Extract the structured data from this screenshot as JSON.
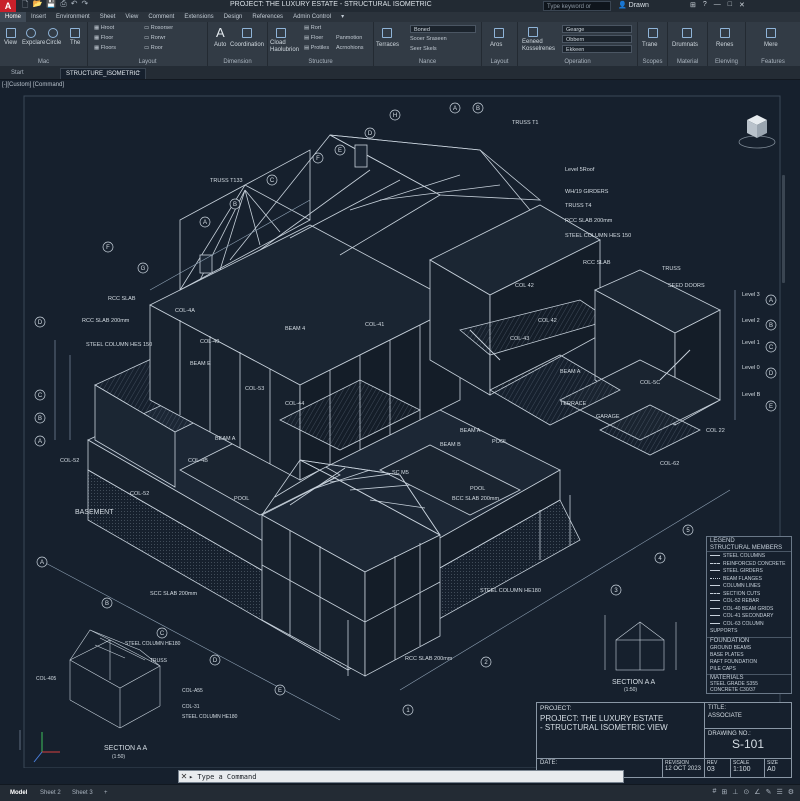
{
  "app": {
    "logo_letter": "A",
    "window_title": "PROJECT: THE LUXURY ESTATE - STRUCTURAL ISOMETRIC",
    "search_placeholder": "Type keyword or phrase",
    "user_name": "Drawn",
    "accent_color": "#c8202a"
  },
  "quick_access": [
    "🗋",
    "📂",
    "💾",
    "⎙",
    "↶",
    "↷"
  ],
  "menu_tabs": [
    "Home",
    "Insert",
    "Environment",
    "Sheet",
    "View",
    "Comment",
    "Extensions",
    "Design",
    "References",
    "Admin Control"
  ],
  "ribbon": {
    "groups": [
      {
        "label": "Mac",
        "tools": [
          "View",
          "Expclare",
          "Circle",
          "The"
        ]
      },
      {
        "label": "Layout",
        "tools": [
          "Hroot",
          "Floor",
          "Floors",
          "Rosorser",
          "Rorwr",
          "Roor"
        ]
      },
      {
        "label": "Dimension",
        "tools": [
          "Auto",
          "Coordination"
        ]
      },
      {
        "label": "Structure",
        "tools": [
          "Cload Haolubrion",
          "Rort",
          "Floer",
          "Protiles",
          "Panmotion",
          "Acrnohions"
        ]
      },
      {
        "label": "Nance",
        "tools": [
          "Terraces",
          "Boned",
          "Sooer Sraseen",
          "Seer Skels"
        ]
      },
      {
        "label": "Layout",
        "tools": [
          "Aros"
        ]
      },
      {
        "label": "Operation",
        "tools": [
          "Eeneed Kosselrenes",
          "Gearge",
          "Obbern",
          "Ekkeen"
        ]
      },
      {
        "label": "Scopes",
        "tools": [
          "Trane"
        ]
      },
      {
        "label": "Material",
        "tools": [
          "Drumnats"
        ]
      },
      {
        "label": "Elenving",
        "tools": [
          "Renes"
        ]
      },
      {
        "label": "Features",
        "tools": [
          "Mere"
        ]
      }
    ]
  },
  "doc_tabs": [
    "Start",
    "STRUCTURE_ISOMETRIC"
  ],
  "view_label": "[-][Custom] [Command]",
  "drawing": {
    "labels": {
      "truss_t1": "TRUSS T1",
      "truss_t133": "TRUSS T133",
      "level_5roof": "Level 5Roof",
      "wh_girders": "WH/19 GIRDERS",
      "truss_t4": "TRUSS T4",
      "rc_slab_200": "RCC SLAB 200mm",
      "steel_col_hes": "STEEL COLUMN HES 150",
      "rcc_slab": "RCC SLAB",
      "truss": "TRUSS",
      "seed_doors": "SEED DOORS",
      "rcc_slab_left": "RCC SLAB",
      "rcc_slab_200mm": "RCC SLAB 200mm",
      "steel_column_hes": "STEEL COLUMN HES 150",
      "col_4a": "COL-4A",
      "col_42": "COL 42",
      "col_41": "COL-41",
      "col_43": "COL-43",
      "col_52": "COL-52",
      "col_40": "COL-40",
      "col_53": "COL-53",
      "col_5c": "COL-5C",
      "col_44": "COL-44",
      "col_22": "COL 22",
      "col_62": "COL-62",
      "col_52b": "COL-52",
      "col_4b": "COL-4B",
      "beam_a": "BEAM A",
      "beam_e": "BEAM E",
      "beam_b": "BEAM B",
      "beam_4": "BEAM 4",
      "basement": "BASEMENT",
      "pool": "POOL",
      "pool2": "POOL",
      "pool3": "POOL",
      "garage": "GARAGE",
      "terrace": "TERRACE",
      "sc_m5": "SC M5",
      "scc_slab": "SCC SLAB 200mm",
      "bcc_slab_200": "BCC SLAB 200mm",
      "steel_column_b": "STEEL COLUMN HE180",
      "rcc_slab_bottom": "RCC SLAB 200mm",
      "level3": "Level 3",
      "level2": "Level 2",
      "level1": "Level 1",
      "level0": "Level 0",
      "level_b": "Level B",
      "section_aa": "SECTION A A",
      "section_aa_sub": "(1:50)",
      "section_a": "SECTION A A",
      "section_a_sub": "(1:50)",
      "steel_column_detail": "STEEL COLUMN HE180",
      "truss_detail": "TRUSS",
      "col_405": "COL-405",
      "col_a55": "COL-A55",
      "col_31": "COL-31",
      "steel_column_hes2": "STEEL COLUMN HE180"
    },
    "grid_letters": [
      "A",
      "B",
      "C",
      "D",
      "E",
      "F",
      "G",
      "H"
    ],
    "grid_numbers": [
      "1",
      "2",
      "3",
      "4",
      "5",
      "6",
      "7",
      "8"
    ]
  },
  "legend": {
    "title": "LEGEND",
    "section_title": "STRUCTURAL MEMBERS",
    "items": [
      "STEEL COLUMNS",
      "REINFORCED CONCRETE",
      "STEEL GIRDERS",
      "BEAM FLANGES",
      "COLUMN LINES",
      "SECTION CUTS",
      "COL-52 REBAR",
      "COL-40 BEAM GRIDS",
      "COL-41 SECONDARY",
      "COL-63 COLUMN SUPPORTS"
    ],
    "foundation_title": "FOUNDATION",
    "foundation_items": [
      "GROUND BEAMS",
      "BASE PLATES",
      "RAFT FOUNDATION",
      "PILE CAPS"
    ],
    "materials_title": "MATERIALS",
    "materials_items": [
      "STEEL GRADE S355",
      "CONCRETE C30/37"
    ]
  },
  "title_block": {
    "project_label": "PROJECT:",
    "project_name": "PROJECT: THE LUXURY ESTATE",
    "project_sub": "- STRUCTURAL ISOMETRIC VIEW",
    "title_label": "TITLE:",
    "title_value": "ASSOCIATE",
    "drawing_no_label": "DRAWING NO.:",
    "drawing_no": "S-101",
    "date_label": "DATE:",
    "revision_label": "REVISION",
    "date_value": "12 OCT 2023",
    "rev_label": "REV",
    "rev_value": "03",
    "scale_label": "SCALE",
    "scale_value": "1:100",
    "size_label": "SIZE",
    "size_value": "A0"
  },
  "command": {
    "prompt": "▸ Type a Command"
  },
  "layout_tabs": [
    "Model",
    "Sheet 2",
    "Sheet 3",
    "+"
  ],
  "status_icons": [
    "#",
    "⊞",
    "⊥",
    "⊙",
    "∠",
    "✎",
    "☰",
    "⚙"
  ]
}
